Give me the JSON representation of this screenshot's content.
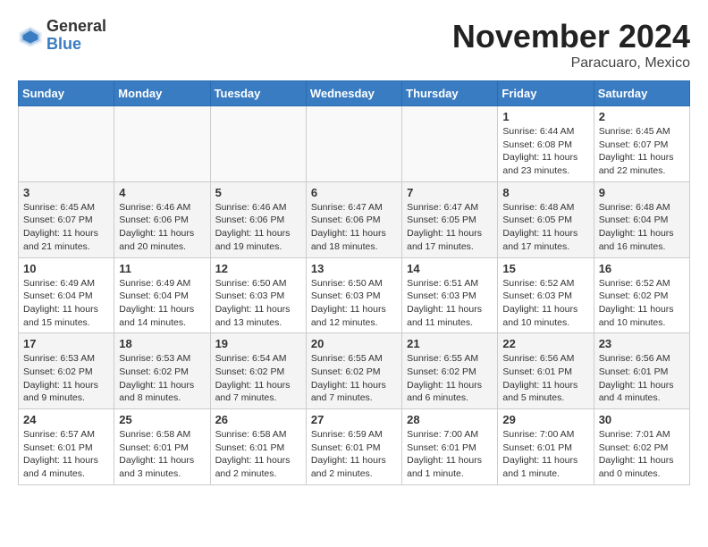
{
  "header": {
    "logo_general": "General",
    "logo_blue": "Blue",
    "month_title": "November 2024",
    "location": "Paracuaro, Mexico"
  },
  "days_of_week": [
    "Sunday",
    "Monday",
    "Tuesday",
    "Wednesday",
    "Thursday",
    "Friday",
    "Saturday"
  ],
  "weeks": [
    [
      {
        "day": "",
        "info": ""
      },
      {
        "day": "",
        "info": ""
      },
      {
        "day": "",
        "info": ""
      },
      {
        "day": "",
        "info": ""
      },
      {
        "day": "",
        "info": ""
      },
      {
        "day": "1",
        "info": "Sunrise: 6:44 AM\nSunset: 6:08 PM\nDaylight: 11 hours and 23 minutes."
      },
      {
        "day": "2",
        "info": "Sunrise: 6:45 AM\nSunset: 6:07 PM\nDaylight: 11 hours and 22 minutes."
      }
    ],
    [
      {
        "day": "3",
        "info": "Sunrise: 6:45 AM\nSunset: 6:07 PM\nDaylight: 11 hours and 21 minutes."
      },
      {
        "day": "4",
        "info": "Sunrise: 6:46 AM\nSunset: 6:06 PM\nDaylight: 11 hours and 20 minutes."
      },
      {
        "day": "5",
        "info": "Sunrise: 6:46 AM\nSunset: 6:06 PM\nDaylight: 11 hours and 19 minutes."
      },
      {
        "day": "6",
        "info": "Sunrise: 6:47 AM\nSunset: 6:06 PM\nDaylight: 11 hours and 18 minutes."
      },
      {
        "day": "7",
        "info": "Sunrise: 6:47 AM\nSunset: 6:05 PM\nDaylight: 11 hours and 17 minutes."
      },
      {
        "day": "8",
        "info": "Sunrise: 6:48 AM\nSunset: 6:05 PM\nDaylight: 11 hours and 17 minutes."
      },
      {
        "day": "9",
        "info": "Sunrise: 6:48 AM\nSunset: 6:04 PM\nDaylight: 11 hours and 16 minutes."
      }
    ],
    [
      {
        "day": "10",
        "info": "Sunrise: 6:49 AM\nSunset: 6:04 PM\nDaylight: 11 hours and 15 minutes."
      },
      {
        "day": "11",
        "info": "Sunrise: 6:49 AM\nSunset: 6:04 PM\nDaylight: 11 hours and 14 minutes."
      },
      {
        "day": "12",
        "info": "Sunrise: 6:50 AM\nSunset: 6:03 PM\nDaylight: 11 hours and 13 minutes."
      },
      {
        "day": "13",
        "info": "Sunrise: 6:50 AM\nSunset: 6:03 PM\nDaylight: 11 hours and 12 minutes."
      },
      {
        "day": "14",
        "info": "Sunrise: 6:51 AM\nSunset: 6:03 PM\nDaylight: 11 hours and 11 minutes."
      },
      {
        "day": "15",
        "info": "Sunrise: 6:52 AM\nSunset: 6:03 PM\nDaylight: 11 hours and 10 minutes."
      },
      {
        "day": "16",
        "info": "Sunrise: 6:52 AM\nSunset: 6:02 PM\nDaylight: 11 hours and 10 minutes."
      }
    ],
    [
      {
        "day": "17",
        "info": "Sunrise: 6:53 AM\nSunset: 6:02 PM\nDaylight: 11 hours and 9 minutes."
      },
      {
        "day": "18",
        "info": "Sunrise: 6:53 AM\nSunset: 6:02 PM\nDaylight: 11 hours and 8 minutes."
      },
      {
        "day": "19",
        "info": "Sunrise: 6:54 AM\nSunset: 6:02 PM\nDaylight: 11 hours and 7 minutes."
      },
      {
        "day": "20",
        "info": "Sunrise: 6:55 AM\nSunset: 6:02 PM\nDaylight: 11 hours and 7 minutes."
      },
      {
        "day": "21",
        "info": "Sunrise: 6:55 AM\nSunset: 6:02 PM\nDaylight: 11 hours and 6 minutes."
      },
      {
        "day": "22",
        "info": "Sunrise: 6:56 AM\nSunset: 6:01 PM\nDaylight: 11 hours and 5 minutes."
      },
      {
        "day": "23",
        "info": "Sunrise: 6:56 AM\nSunset: 6:01 PM\nDaylight: 11 hours and 4 minutes."
      }
    ],
    [
      {
        "day": "24",
        "info": "Sunrise: 6:57 AM\nSunset: 6:01 PM\nDaylight: 11 hours and 4 minutes."
      },
      {
        "day": "25",
        "info": "Sunrise: 6:58 AM\nSunset: 6:01 PM\nDaylight: 11 hours and 3 minutes."
      },
      {
        "day": "26",
        "info": "Sunrise: 6:58 AM\nSunset: 6:01 PM\nDaylight: 11 hours and 2 minutes."
      },
      {
        "day": "27",
        "info": "Sunrise: 6:59 AM\nSunset: 6:01 PM\nDaylight: 11 hours and 2 minutes."
      },
      {
        "day": "28",
        "info": "Sunrise: 7:00 AM\nSunset: 6:01 PM\nDaylight: 11 hours and 1 minute."
      },
      {
        "day": "29",
        "info": "Sunrise: 7:00 AM\nSunset: 6:01 PM\nDaylight: 11 hours and 1 minute."
      },
      {
        "day": "30",
        "info": "Sunrise: 7:01 AM\nSunset: 6:02 PM\nDaylight: 11 hours and 0 minutes."
      }
    ]
  ]
}
